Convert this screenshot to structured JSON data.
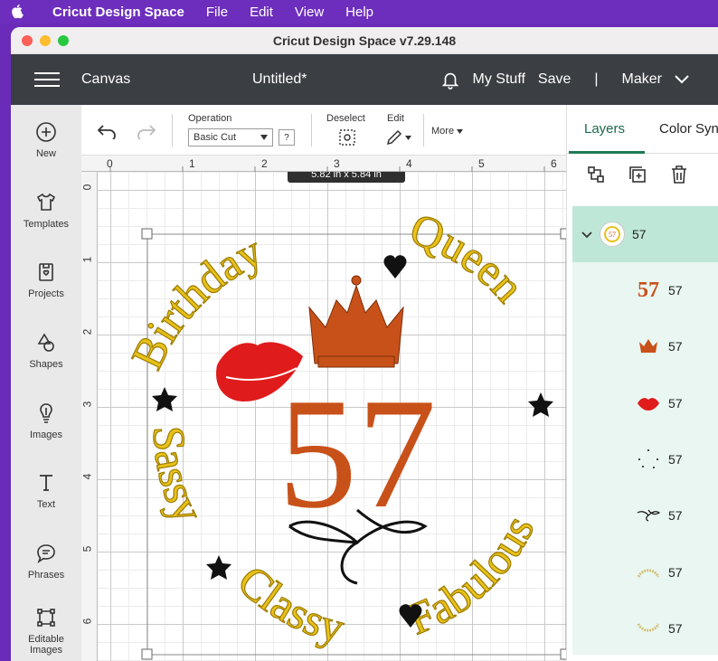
{
  "menubar": {
    "app_name": "Cricut Design Space",
    "items": [
      "File",
      "Edit",
      "View",
      "Help"
    ]
  },
  "window": {
    "title": "Cricut Design Space  v7.29.148"
  },
  "header": {
    "canvas_label": "Canvas",
    "doc_title": "Untitled*",
    "my_stuff": "My Stuff",
    "save": "Save",
    "separator": "|",
    "machine": "Maker"
  },
  "sidebar": {
    "items": [
      {
        "label": "New",
        "icon": "plus-circle-icon"
      },
      {
        "label": "Templates",
        "icon": "shirt-icon"
      },
      {
        "label": "Projects",
        "icon": "projects-icon"
      },
      {
        "label": "Shapes",
        "icon": "shapes-icon"
      },
      {
        "label": "Images",
        "icon": "lightbulb-icon"
      },
      {
        "label": "Text",
        "icon": "text-icon"
      },
      {
        "label": "Phrases",
        "icon": "speech-bubble-icon"
      },
      {
        "label": "Editable Images",
        "icon": "editable-images-icon"
      }
    ]
  },
  "toolbar": {
    "operation_label": "Operation",
    "operation_value": "Basic Cut",
    "help": "?",
    "deselect_label": "Deselect",
    "edit_label": "Edit",
    "more_label": "More"
  },
  "canvas": {
    "ruler_top": [
      "0",
      "1",
      "2",
      "3",
      "4",
      "5",
      "6"
    ],
    "ruler_left": [
      "0",
      "1",
      "2",
      "3",
      "4",
      "5",
      "6"
    ],
    "dimension_tag": "5.82 in x 5.84 in",
    "design": {
      "top_left_text": "Birthday",
      "top_right_text": "Queen",
      "left_text": "Sassy",
      "bottom_text": "Classy",
      "right_text": "Fabulous",
      "number": "57"
    },
    "colors": {
      "gold": "#e8c21a",
      "gold_outline": "#b08a00",
      "orange": "#c8511a",
      "red": "#e01b1b",
      "black": "#111111"
    }
  },
  "right_panel": {
    "tabs": [
      "Layers",
      "Color Sync"
    ],
    "group": {
      "label": "57"
    },
    "layers": [
      {
        "label": "57",
        "thumb": "57"
      },
      {
        "label": "57",
        "thumb": "crown"
      },
      {
        "label": "57",
        "thumb": "lips"
      },
      {
        "label": "57",
        "thumb": "stars"
      },
      {
        "label": "57",
        "thumb": "swirl"
      },
      {
        "label": "57",
        "thumb": "arc-top"
      },
      {
        "label": "57",
        "thumb": "arc-bottom"
      }
    ]
  }
}
